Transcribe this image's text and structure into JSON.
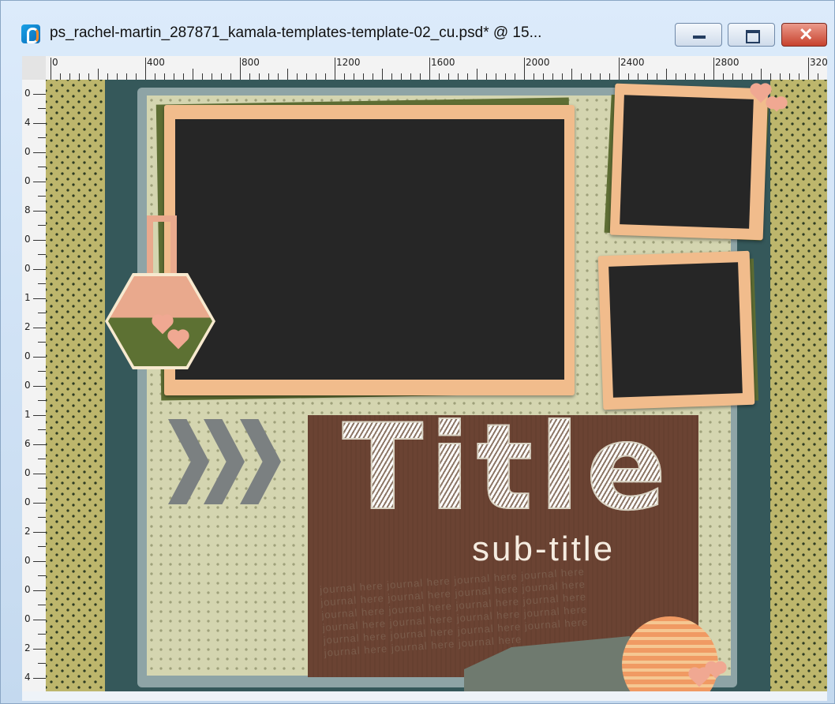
{
  "window": {
    "title": "ps_rachel-martin_287871_kamala-templates-template-02_cu.psd* @  15...",
    "minimize_symbol": "",
    "maximize_symbol": "",
    "close_symbol": "✕"
  },
  "ruler": {
    "horizontal_labels": [
      "0",
      "400",
      "800",
      "1200",
      "1600",
      "2000",
      "2400",
      "2800",
      "320"
    ],
    "vertical_labels": [
      "0",
      "4",
      "0",
      "0",
      "8",
      "0",
      "0",
      "1",
      "2",
      "0",
      "0",
      "1",
      "6",
      "0",
      "0",
      "2",
      "0",
      "0",
      "0",
      "2",
      "4"
    ]
  },
  "canvas": {
    "title_text": "Title",
    "subtitle_text": "sub-title",
    "journal_lines": [
      "journal  here  journal  here  journal  here  journal  here",
      "journal  here  journal  here  journal  here  journal  here",
      "journal  here  journal  here  journal  here  journal  here",
      "journal  here  journal  here  journal  here  journal  here",
      "journal  here  journal  here  journal  here  journal  here",
      "journal  here  journal  here  journal  here"
    ]
  },
  "colors": {
    "background_side": "#bdb66c",
    "dark_teal": "#35585a",
    "paper": "#d4d5b0",
    "frame_peach": "#f1bc8c",
    "title_panel": "#6b4333"
  },
  "icons": {
    "app": "paint-shop-pro-icon",
    "minimize": "minimize-icon",
    "maximize": "maximize-icon",
    "close": "close-icon"
  }
}
